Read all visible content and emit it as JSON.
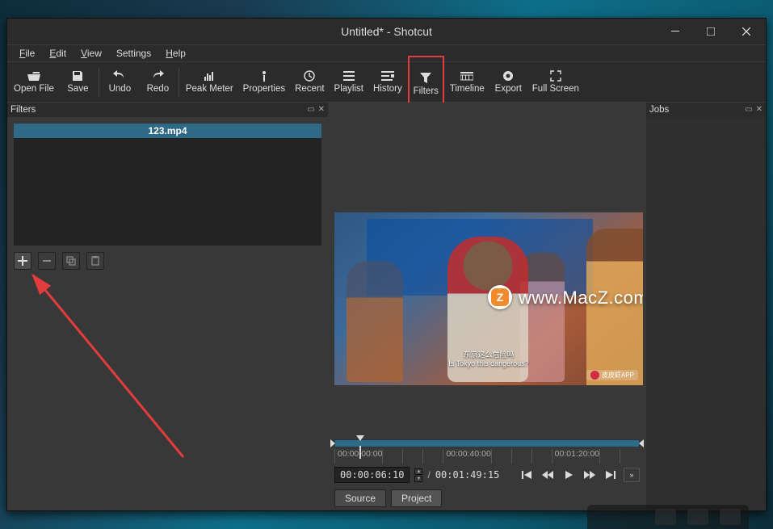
{
  "window": {
    "title": "Untitled* - Shotcut"
  },
  "menu": {
    "file": "File",
    "edit": "Edit",
    "view": "View",
    "settings": "Settings",
    "help": "Help"
  },
  "toolbar": {
    "open": "Open File",
    "save": "Save",
    "undo": "Undo",
    "redo": "Redo",
    "peakmeter": "Peak Meter",
    "properties": "Properties",
    "recent": "Recent",
    "playlist": "Playlist",
    "history": "History",
    "filters": "Filters",
    "timeline": "Timeline",
    "export": "Export",
    "fullscreen": "Full Screen"
  },
  "panels": {
    "filters_title": "Filters",
    "jobs_title": "Jobs"
  },
  "clip": {
    "name": "123.mp4"
  },
  "watermark": {
    "badge_letter": "Z",
    "text": "www.MacZ.com",
    "subtitle": "东京这么危险吗\nIs Tokyo this dangerous?",
    "corner": "皮皮虾APP"
  },
  "ruler": {
    "t0": "00:00:00:00",
    "t1": "00:00:40:00",
    "t2": "00:01:20:00"
  },
  "transport": {
    "current": "00:00:06:10",
    "duration": "00:01:49:15"
  },
  "tabs": {
    "source": "Source",
    "project": "Project"
  }
}
